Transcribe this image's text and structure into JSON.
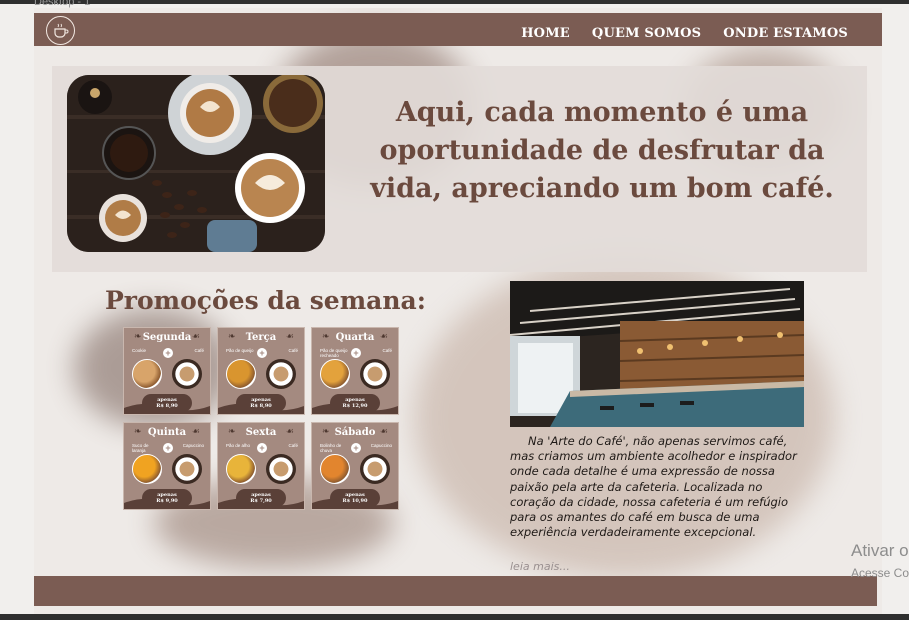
{
  "frame": {
    "label": "Desktop - 1"
  },
  "header": {
    "logo_icon": "coffee-cup-logo-icon",
    "nav": [
      {
        "label": "HOME"
      },
      {
        "label": "QUEM SOMOS"
      },
      {
        "label": "ONDE ESTAMOS"
      }
    ]
  },
  "hero": {
    "image_icon": "coffee-cups-photo",
    "headline": "Aqui, cada momento é uma oportunidade de desfrutar da vida, apreciando um bom café."
  },
  "promotions": {
    "title": "Promoções da semana:",
    "cards": [
      {
        "day": "Segunda",
        "item_a": "Cookie",
        "item_b": "Café",
        "price_label": "apenas",
        "price": "R$ 8,90"
      },
      {
        "day": "Terça",
        "item_a": "Pão de queijo",
        "item_b": "Café",
        "price_label": "apenas",
        "price": "R$ 8,90"
      },
      {
        "day": "Quarta",
        "item_a": "Pão de queijo recheado",
        "item_b": "Café",
        "price_label": "apenas",
        "price": "R$ 12,90"
      },
      {
        "day": "Quinta",
        "item_a": "Suco de laranja",
        "item_b": "Capuccino",
        "price_label": "apenas",
        "price": "R$ 9,90"
      },
      {
        "day": "Sexta",
        "item_a": "Pão de alho",
        "item_b": "Café",
        "price_label": "apenas",
        "price": "R$ 7,90"
      },
      {
        "day": "Sábado",
        "item_a": "Bolinho de chuva",
        "item_b": "Capuccino",
        "price_label": "apenas",
        "price": "R$ 10,90"
      }
    ]
  },
  "about": {
    "image_icon": "cafe-interior-photo",
    "text": "Na 'Arte do Café', não apenas servimos café, mas criamos um ambiente acolhedor e inspirador onde cada detalhe é uma expressão de nossa paixão pela arte da cafeteria. Localizada no coração da cidade, nossa cafeteria é um refúgio para os amantes do café em busca de uma experiência verdadeiramente excepcional.",
    "read_more": "leia mais..."
  },
  "watermark": {
    "title": "Ativar o",
    "subtitle": "Acesse Co"
  },
  "colors": {
    "brand": "#7b5c53",
    "heading": "#6b4a3e",
    "card": "#a48a80"
  }
}
